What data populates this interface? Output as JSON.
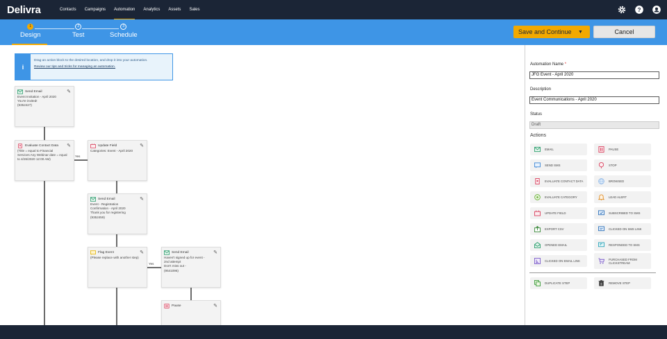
{
  "app": {
    "logo": "Delivra"
  },
  "nav": {
    "items": [
      "Contacts",
      "Campaigns",
      "Automation",
      "Analytics",
      "Assets",
      "Sales"
    ],
    "active": "Automation"
  },
  "top_icons": [
    "gear-icon",
    "help-icon",
    "user-icon"
  ],
  "steps": [
    {
      "num": "1",
      "label": "Design",
      "active": true
    },
    {
      "num": "2",
      "label": "Test",
      "active": false
    },
    {
      "num": "3",
      "label": "Schedule",
      "active": false
    }
  ],
  "buttons": {
    "save": "Save and Continue",
    "cancel": "Cancel"
  },
  "info": {
    "text": "Drag an action block to the desired location, and drop it into your automation.",
    "link": "Review our tips and tricks for managing an automation."
  },
  "nodes": {
    "n1": {
      "title": "Send Email",
      "lines": [
        "Event Invitation - April 2020",
        "You're invited!",
        "(9352427)"
      ]
    },
    "n2": {
      "title": "Evaluate Contact Data",
      "lines": [
        "(Title = equal to Financial",
        "Services Any Webinar date = equal",
        "to 4/26/2020 12:00 AM)"
      ]
    },
    "n3": {
      "title": "Update Field",
      "lines": [
        "Categories: Event - April 2020"
      ]
    },
    "n4": {
      "title": "Send Email",
      "lines": [
        "Event - Registration",
        "Confirmation - April 2020",
        "Thank you for registering",
        "(9352459)"
      ]
    },
    "n5": {
      "title": "Flag Event",
      "lines": [
        "(Please replace with another step)"
      ]
    },
    "n6": {
      "title": "Send Email",
      "lines": [
        "Haven't signed up for event -",
        "2nd attempt",
        "Don't miss out -",
        "(9541096)"
      ]
    },
    "n7": {
      "title": "Pause",
      "lines": []
    }
  },
  "connector_labels": {
    "yes1": "Yes",
    "yes2": "Yes"
  },
  "panel": {
    "name_label": "Automation Name",
    "name_required": "*",
    "name_value": "JFG Event - April 2020",
    "desc_label": "Description",
    "desc_value": "Event Communications - April 2020",
    "status_label": "Status",
    "status_value": "Draft",
    "actions_title": "Actions",
    "actions_left": [
      "EMAIL",
      "SEND SMS",
      "EVALUATE CONTACT DATA",
      "EVALUATE CATEGORY",
      "UPDATE FIELD",
      "EXPORT CSV",
      "OPENED EMAIL",
      "CLICKED ON EMAIL LINK"
    ],
    "actions_right": [
      "PAUSE",
      "STOP",
      "BROWSED",
      "LEAD ALERT",
      "SUBSCRIBED TO SMS",
      "CLICKED ON SMS LINK",
      "RESPONDED TO SMS",
      "PURCHASED FROM CLICKSTREAM"
    ],
    "duplicate": "DUPLICATE STEP",
    "remove": "REMOVE STEP"
  },
  "colors": {
    "nav": "#1b2536",
    "stepbar": "#3e95e6",
    "accent": "#f2a900"
  }
}
